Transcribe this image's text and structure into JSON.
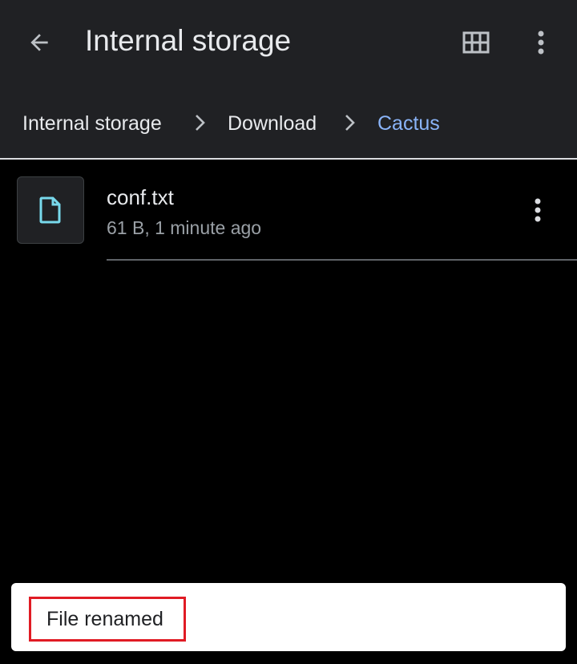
{
  "appbar": {
    "title": "Internal storage",
    "back_icon": "arrow-back-icon",
    "grid_icon": "grid-view-icon",
    "more_icon": "more-vert-icon"
  },
  "breadcrumbs": [
    {
      "label": "Internal storage",
      "active": false
    },
    {
      "label": "Download",
      "active": false
    },
    {
      "label": "Cactus",
      "active": true
    }
  ],
  "files": [
    {
      "name": "conf.txt",
      "meta": "61 B, 1 minute ago",
      "icon": "document-icon"
    }
  ],
  "snackbar": {
    "message": "File renamed"
  },
  "colors": {
    "background": "#000000",
    "appbar": "#202124",
    "text_primary": "#e8eaed",
    "text_secondary": "#9aa0a6",
    "accent": "#8ab4f8",
    "file_icon": "#78d9ec",
    "highlight": "#e01b24"
  }
}
